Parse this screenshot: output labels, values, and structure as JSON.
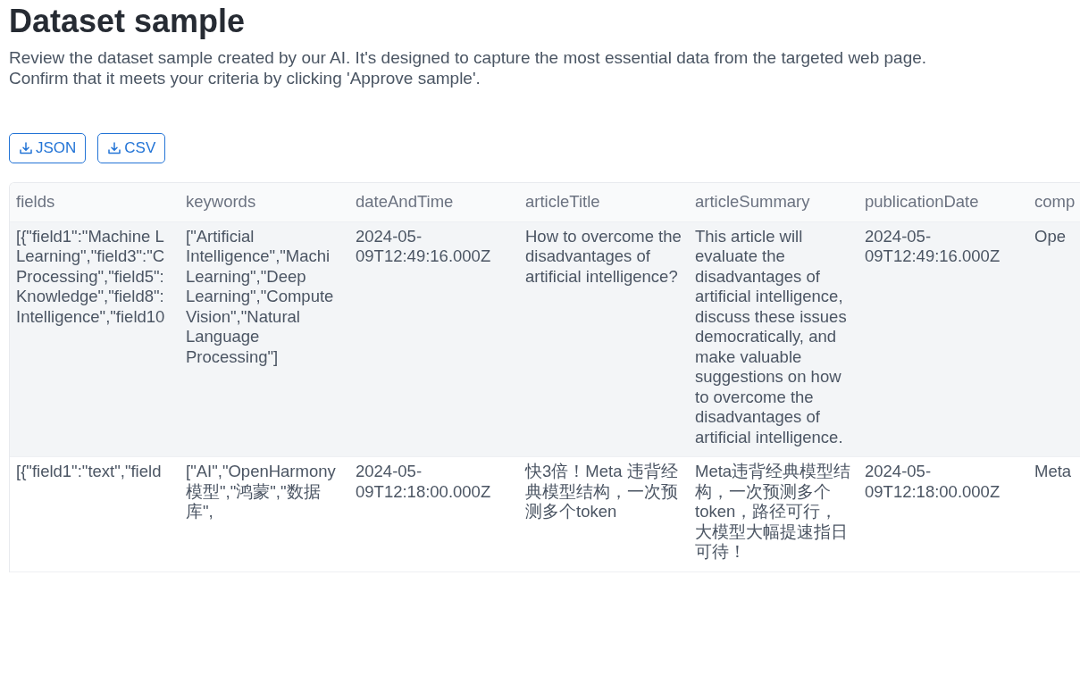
{
  "page": {
    "title": "Dataset sample",
    "description": [
      "Review the dataset sample created by our AI. It's designed to capture the most essential data from the targeted web page.",
      "Confirm that it meets your criteria by clicking 'Approve sample'."
    ]
  },
  "buttons": [
    {
      "label": "JSON"
    },
    {
      "label": "CSV"
    }
  ],
  "table": {
    "columns": [
      "fields",
      "keywords",
      "dateAndTime",
      "articleTitle",
      "articleSummary",
      "publicationDate",
      "comp"
    ],
    "rows": [
      {
        "highlighted": true,
        "cells": [
          "[{\"field1\":\"Machine L\nLearning\",\"field3\":\"C\nProcessing\",\"field5\":\nKnowledge\",\"field8\":\nIntelligence\",\"field10",
          "[\"Artificial\nIntelligence\",\"Machi\nLearning\",\"Deep\nLearning\",\"Compute\nVision\",\"Natural\nLanguage\nProcessing\"]",
          "2024-05-09T12:49:16.000Z",
          "How to overcome the disadvantages of artificial intelligence?",
          "This article will evaluate the disadvantages of artificial intelligence, discuss these issues democratically, and make valuable suggestions on how to overcome the disadvantages of artificial intelligence.",
          "2024-05-09T12:49:16.000Z",
          "Ope"
        ]
      },
      {
        "highlighted": false,
        "cells": [
          "[{\"field1\":\"text\",\"field",
          "[\"AI\",\"OpenHarmony\n模型\",\"鸿蒙\",\"数据库\",",
          "2024-05-09T12:18:00.000Z",
          "快3倍！Meta 违背经典模型结构，一次预测多个token",
          "Meta违背经典模型结构，一次预测多个token，路径可行，大模型大幅提速指日可待！",
          "2024-05-09T12:18:00.000Z",
          "Meta"
        ]
      }
    ]
  }
}
